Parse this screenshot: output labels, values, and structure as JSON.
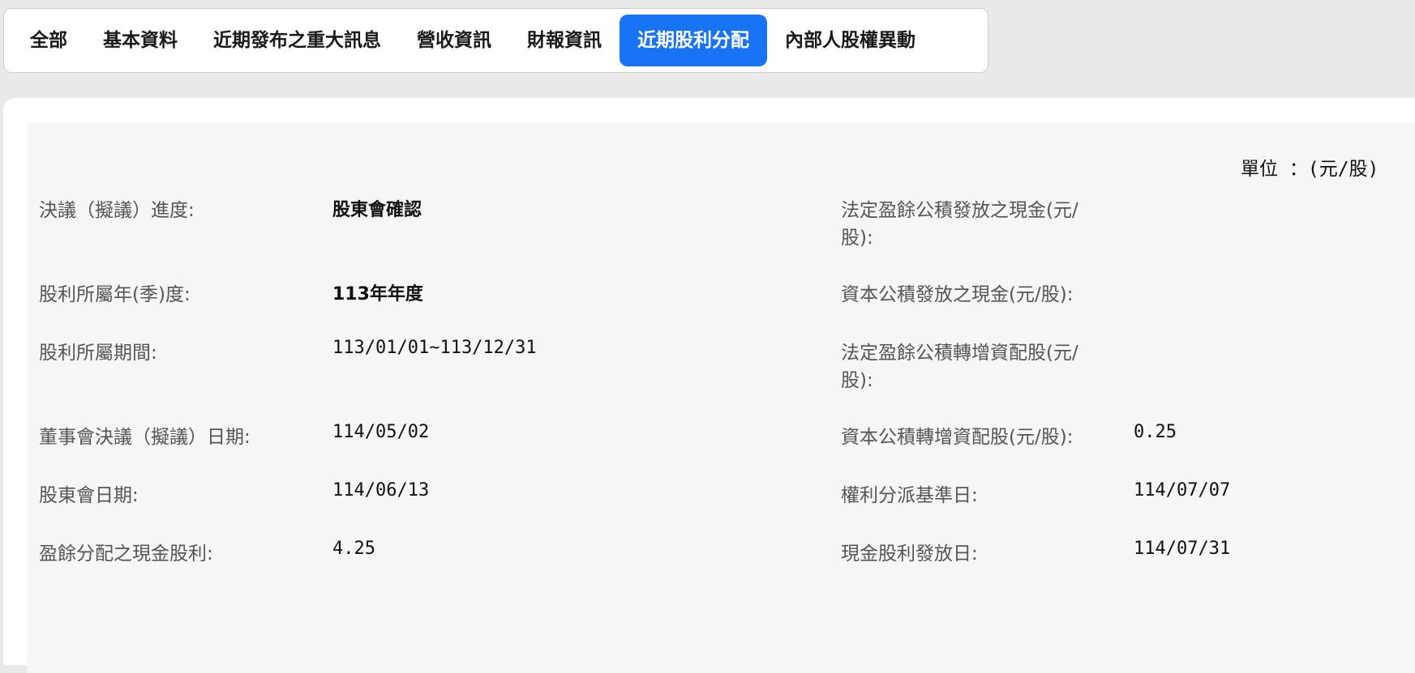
{
  "tabs": [
    {
      "label": "全部",
      "active": false
    },
    {
      "label": "基本資料",
      "active": false
    },
    {
      "label": "近期發布之重大訊息",
      "active": false
    },
    {
      "label": "營收資訊",
      "active": false
    },
    {
      "label": "財報資訊",
      "active": false
    },
    {
      "label": "近期股利分配",
      "active": true
    },
    {
      "label": "內部人股權異動",
      "active": false
    }
  ],
  "unit_label": "單位 ：(元/股)",
  "rows": [
    {
      "left_label": "決議（擬議）進度:",
      "left_value": "股東會確認",
      "right_label": "法定盈餘公積發放之現金(元/股):",
      "right_value": ""
    },
    {
      "left_label": "股利所屬年(季)度:",
      "left_value": "113年年度",
      "right_label": "資本公積發放之現金(元/股):",
      "right_value": ""
    },
    {
      "left_label": "股利所屬期間:",
      "left_value": "113/01/01~113/12/31",
      "right_label": "法定盈餘公積轉增資配股(元/股):",
      "right_value": ""
    },
    {
      "left_label": "董事會決議（擬議）日期:",
      "left_value": "114/05/02",
      "right_label": "資本公積轉增資配股(元/股):",
      "right_value": "0.25"
    },
    {
      "left_label": "股東會日期:",
      "left_value": "114/06/13",
      "right_label": "權利分派基準日:",
      "right_value": "114/07/07"
    },
    {
      "left_label": "盈餘分配之現金股利:",
      "left_value": "4.25",
      "right_label": "現金股利發放日:",
      "right_value": "114/07/31"
    }
  ],
  "colors": {
    "accent": "#1874f4",
    "background": "#e9e9e9",
    "card": "#f6f6f6"
  }
}
